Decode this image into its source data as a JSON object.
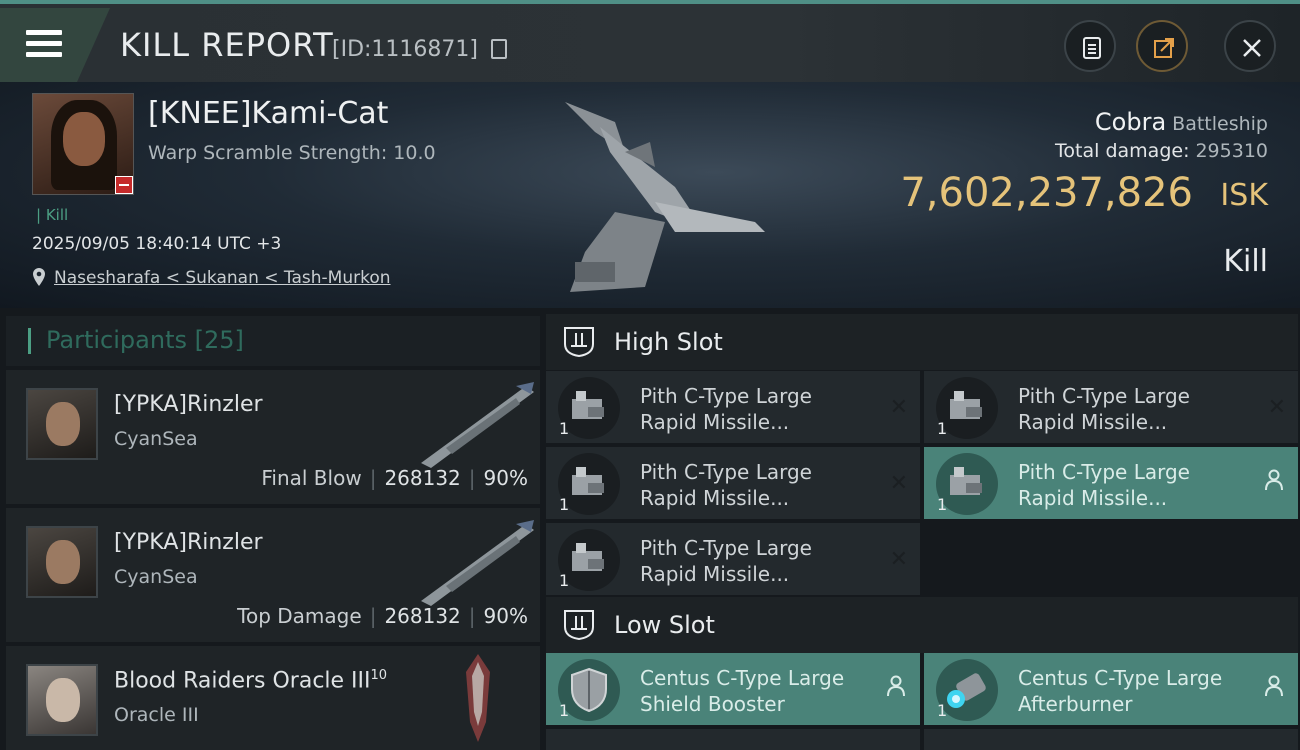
{
  "header": {
    "title": "KILL REPORT",
    "report_id": "[ID:1116871]"
  },
  "victim": {
    "name": "[KNEE]Kami-Cat",
    "warp_scramble": "Warp Scramble Strength: 10.0",
    "kill_tag": "| Kill",
    "datetime": "2025/09/05 18:40:14 UTC +3",
    "location": "Nasesharafa < Sukanan < Tash-Murkon",
    "ship": "Cobra",
    "ship_class": "Battleship",
    "total_damage_label": "Total damage:",
    "total_damage": "295310",
    "isk_value": "7,602,237,826",
    "isk_unit": "ISK",
    "result": "Kill"
  },
  "participants": {
    "label": "Participants",
    "count": "[25]",
    "items": [
      {
        "name": "[YPKA]Rinzler",
        "corp": "CyanSea",
        "role": "Final Blow",
        "damage": "268132",
        "percent": "90%"
      },
      {
        "name": "[YPKA]Rinzler",
        "corp": "CyanSea",
        "role": "Top Damage",
        "damage": "268132",
        "percent": "90%"
      },
      {
        "name": "Blood Raiders Oracle III",
        "level": "10",
        "corp": "Oracle III"
      }
    ]
  },
  "slots": {
    "high": {
      "label": "High Slot",
      "items": [
        {
          "line1": "Pith C-Type Large",
          "line2": "Rapid Missile...",
          "qty": "1",
          "state": "destroyed"
        },
        {
          "line1": "Pith C-Type Large",
          "line2": "Rapid Missile...",
          "qty": "1",
          "state": "destroyed"
        },
        {
          "line1": "Pith C-Type Large",
          "line2": "Rapid Missile...",
          "qty": "1",
          "state": "destroyed"
        },
        {
          "line1": "Pith C-Type Large",
          "line2": "Rapid Missile...",
          "qty": "1",
          "state": "dropped"
        },
        {
          "line1": "Pith C-Type Large",
          "line2": "Rapid Missile...",
          "qty": "1",
          "state": "destroyed"
        }
      ]
    },
    "low": {
      "label": "Low Slot",
      "items": [
        {
          "line1": "Centus C-Type Large",
          "line2": "Shield Booster",
          "qty": "1",
          "state": "dropped"
        },
        {
          "line1": "Centus C-Type Large",
          "line2": "Afterburner",
          "qty": "1",
          "state": "dropped"
        }
      ]
    }
  },
  "colors": {
    "accent": "#4c9f84",
    "isk": "#e5c37a",
    "dropped_bg": "#4a8379",
    "destroyed_bg": "#23292d"
  }
}
